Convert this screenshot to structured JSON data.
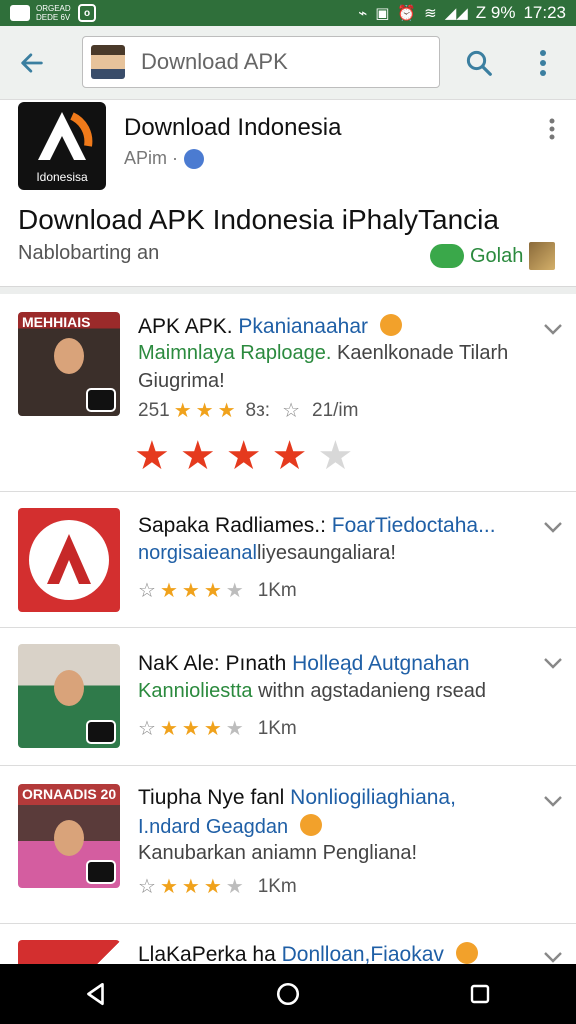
{
  "status_bar": {
    "small_text": "ORGEAD DEDE 6V",
    "signal_text": "Z 9%",
    "time": "17:23"
  },
  "search": {
    "query": "Download APK"
  },
  "featured": {
    "icon_label": "Idonesisa",
    "title": "Download Indonesia",
    "publisher": "APim ·",
    "headline": "Download APK Indonesia iPhalyTancia",
    "description": "Nablobarting an",
    "badge_text": "Golah"
  },
  "apps": [
    {
      "thumb_label": "MEHHIAIS",
      "title_black": "APK APK.",
      "title_blue": "Pkanianaahar",
      "line1_green": "Maimnlaya Raploage.",
      "line1_gray": "Kaenlkonade Tilarh",
      "line2": "Giugrima!",
      "rating_text": "251",
      "extra_1": "8з:",
      "extra_2": "21/іm",
      "stars_big": 4
    },
    {
      "thumb_label": "",
      "title_black": "Sapaka Radliames.: ",
      "title_blue": "FoarTiedoctaha...",
      "line1_green": "norgisaieanal",
      "line1_gray": "liyesaungaliara!",
      "rating_text": "1Km",
      "stars": 3
    },
    {
      "thumb_label": "",
      "title_black": "NaK Ale: Pınath",
      "title_blue": "Holleąd Autgnahan",
      "line1_green": "Kannioliestta",
      "line1_gray": "withn agstadanieng rsead",
      "rating_text": "1Km",
      "stars": 3
    },
    {
      "thumb_label": "ORNAADIS 20",
      "title_black": "Tiupha Nye fanl",
      "title_blue": "Nonliogiliaghiana,",
      "line1_green": "",
      "line1_blue": "I.ndard Geagdan",
      "line2": "Kanubarkan aniamn Pengliana!",
      "rating_text": "1Km",
      "stars": 3
    },
    {
      "title_black": "LlaKaPerka ha",
      "title_blue": "Donlloan,Fiaokav"
    }
  ],
  "colors": {
    "status_bar": "#2f6f3a",
    "toolbar": "#eef1ef",
    "accent_green": "#2b8a3e",
    "link_blue": "#1f5fa6",
    "star_orange": "#f0a21c",
    "big_star_red": "#e53a1e"
  },
  "icons": [
    "back-arrow-icon",
    "search-icon",
    "more-vert-icon",
    "chevron-down-icon",
    "globe-icon",
    "verified-icon",
    "star-icon",
    "nav-back-icon",
    "nav-home-icon",
    "nav-recents-icon"
  ]
}
